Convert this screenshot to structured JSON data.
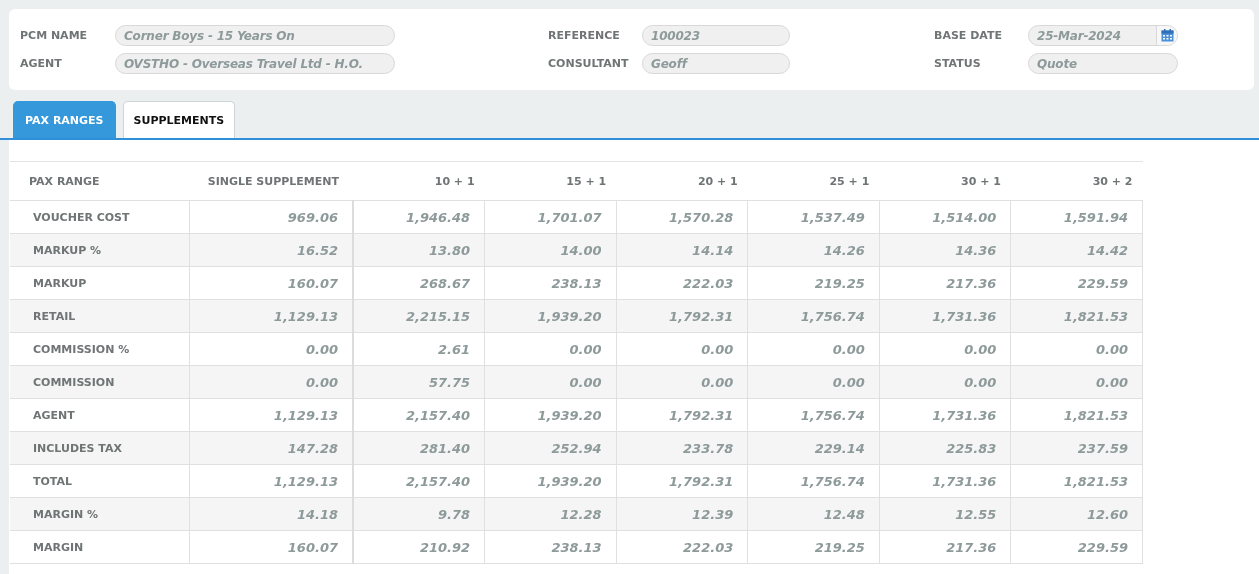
{
  "header": {
    "fields": [
      {
        "label": "PCM NAME",
        "value": "Corner Boys - 15 Years On",
        "kind": "text"
      },
      {
        "label": "REFERENCE",
        "value": "100023",
        "kind": "text"
      },
      {
        "label": "BASE DATE",
        "value": "25-Mar-2024",
        "kind": "date"
      },
      {
        "label": "AGENT",
        "value": "OVSTHO - Overseas Travel Ltd - H.O.",
        "kind": "text"
      },
      {
        "label": "CONSULTANT",
        "value": "Geoff",
        "kind": "text"
      },
      {
        "label": "STATUS",
        "value": "Quote",
        "kind": "text"
      }
    ]
  },
  "tabs": [
    {
      "label": "PAX RANGES",
      "selected": true
    },
    {
      "label": "SUPPLEMENTS",
      "selected": false
    }
  ],
  "table": {
    "columns": [
      "PAX RANGE",
      "SINGLE SUPPLEMENT",
      "10 + 1",
      "15 + 1",
      "20 + 1",
      "25 + 1",
      "30 + 1",
      "30 + 2"
    ],
    "rows": [
      {
        "label": "VOUCHER COST",
        "values": [
          "969.06",
          "1,946.48",
          "1,701.07",
          "1,570.28",
          "1,537.49",
          "1,514.00",
          "1,591.94"
        ]
      },
      {
        "label": "MARKUP %",
        "values": [
          "16.52",
          "13.80",
          "14.00",
          "14.14",
          "14.26",
          "14.36",
          "14.42"
        ]
      },
      {
        "label": "MARKUP",
        "values": [
          "160.07",
          "268.67",
          "238.13",
          "222.03",
          "219.25",
          "217.36",
          "229.59"
        ]
      },
      {
        "label": "RETAIL",
        "values": [
          "1,129.13",
          "2,215.15",
          "1,939.20",
          "1,792.31",
          "1,756.74",
          "1,731.36",
          "1,821.53"
        ]
      },
      {
        "label": "COMMISSION %",
        "values": [
          "0.00",
          "2.61",
          "0.00",
          "0.00",
          "0.00",
          "0.00",
          "0.00"
        ]
      },
      {
        "label": "COMMISSION",
        "values": [
          "0.00",
          "57.75",
          "0.00",
          "0.00",
          "0.00",
          "0.00",
          "0.00"
        ]
      },
      {
        "label": "AGENT",
        "values": [
          "1,129.13",
          "2,157.40",
          "1,939.20",
          "1,792.31",
          "1,756.74",
          "1,731.36",
          "1,821.53"
        ]
      },
      {
        "label": "INCLUDES TAX",
        "values": [
          "147.28",
          "281.40",
          "252.94",
          "233.78",
          "229.14",
          "225.83",
          "237.59"
        ]
      },
      {
        "label": "TOTAL",
        "values": [
          "1,129.13",
          "2,157.40",
          "1,939.20",
          "1,792.31",
          "1,756.74",
          "1,731.36",
          "1,821.53"
        ]
      },
      {
        "label": "MARGIN %",
        "values": [
          "14.18",
          "9.78",
          "12.28",
          "12.39",
          "12.48",
          "12.55",
          "12.60"
        ]
      },
      {
        "label": "MARGIN",
        "values": [
          "160.07",
          "210.92",
          "238.13",
          "222.03",
          "219.25",
          "217.36",
          "229.59"
        ]
      }
    ]
  }
}
